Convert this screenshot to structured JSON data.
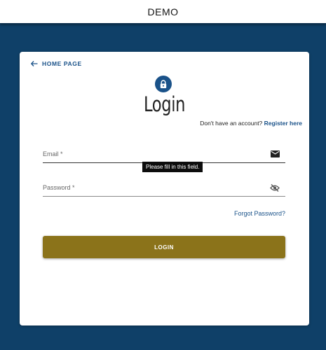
{
  "app": {
    "title": "DEMO"
  },
  "card": {
    "back_label": "HOME PAGE",
    "heading": "Login",
    "register_prompt": "Don't have an account?",
    "register_link": "Register here",
    "tooltip": "Please fill in this field.",
    "forgot_password": "Forgot Password?",
    "login_button": "LOGIN"
  },
  "fields": {
    "email": {
      "label": "Email *",
      "value": "",
      "icon": "mail-icon"
    },
    "password": {
      "label": "Password *",
      "value": "",
      "icon": "visibility-off-icon"
    }
  },
  "colors": {
    "background": "#0f4068",
    "accent": "#1a5289",
    "button": "#8b731a",
    "card": "#ffffff"
  }
}
